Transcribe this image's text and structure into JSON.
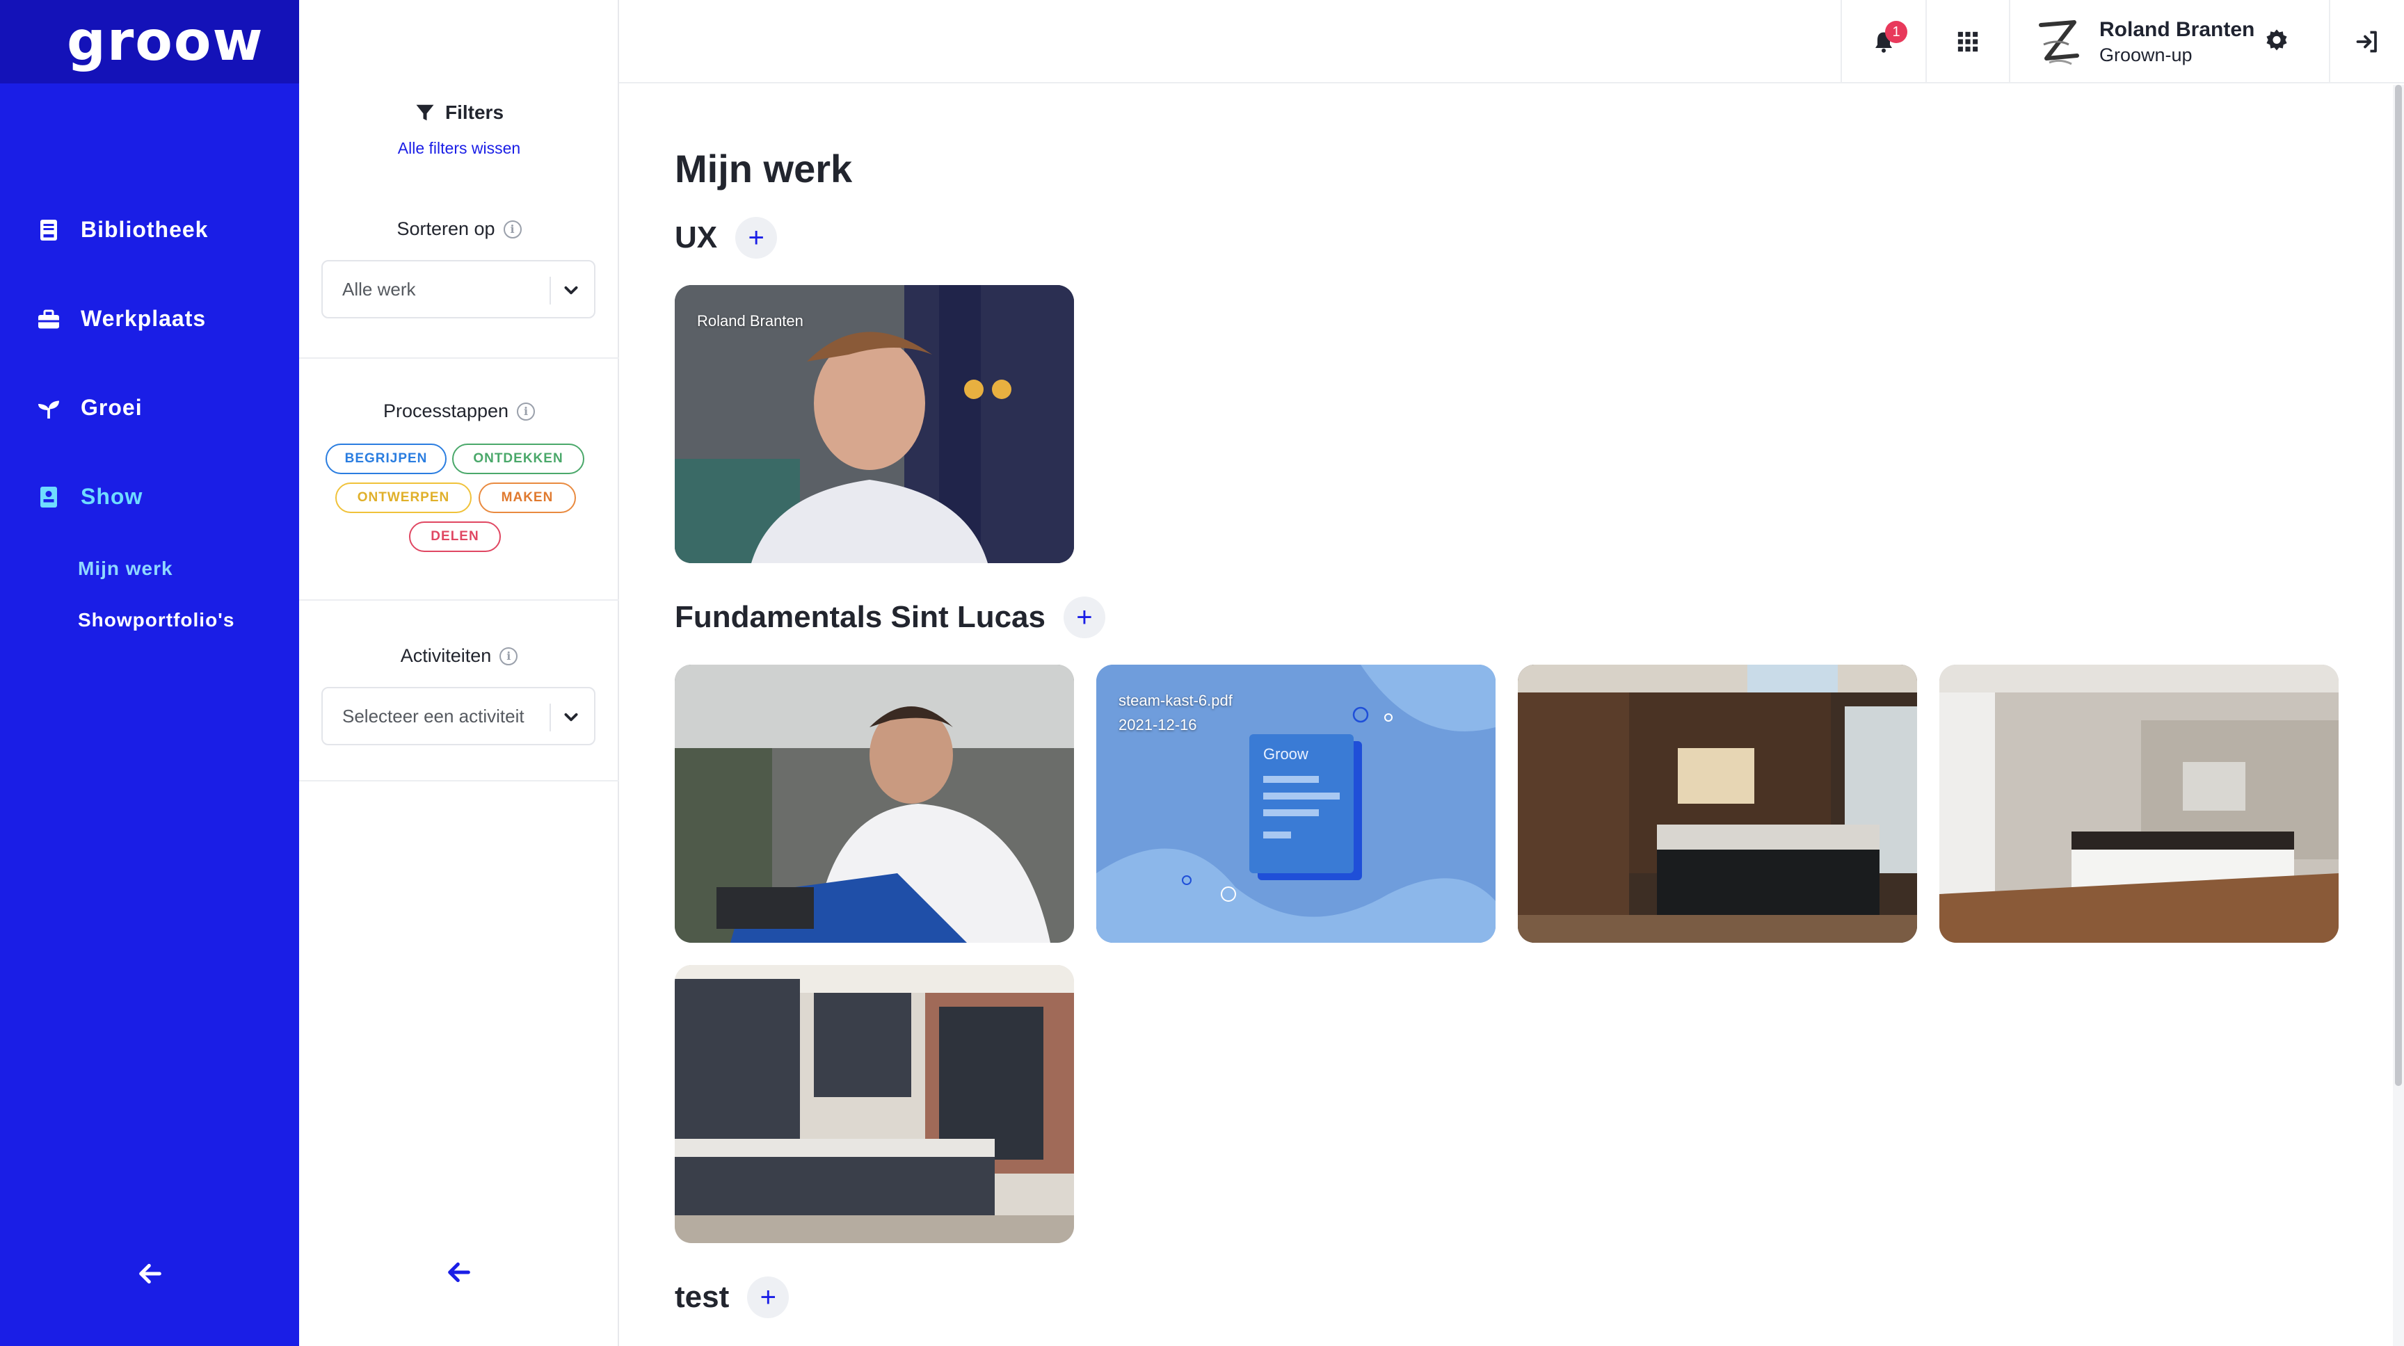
{
  "nav": {
    "logo": "groow",
    "items": [
      {
        "label": "Bibliotheek",
        "icon": "book-icon"
      },
      {
        "label": "Werkplaats",
        "icon": "toolbox-icon"
      },
      {
        "label": "Groei",
        "icon": "sprout-icon"
      },
      {
        "label": "Show",
        "icon": "portfolio-icon"
      }
    ],
    "subitems": [
      {
        "label": "Mijn werk"
      },
      {
        "label": "Showportfolio's"
      }
    ],
    "colors": {
      "background": "#1a1ee6",
      "active": "#6fdcff"
    }
  },
  "filters": {
    "title": "Filters",
    "clear_all": "Alle filters wissen",
    "sort": {
      "label": "Sorteren op",
      "value": "Alle werk"
    },
    "process": {
      "label": "Processtappen",
      "chips": [
        "BEGRIJPEN",
        "ONTDEKKEN",
        "ONTWERPEN",
        "MAKEN",
        "DELEN"
      ]
    },
    "activities": {
      "label": "Activiteiten",
      "value": "Selecteer een activiteit"
    }
  },
  "topbar": {
    "notifications_count": "1",
    "user": {
      "name": "Roland Branten",
      "role": "Groown-up"
    }
  },
  "main": {
    "title": "Mijn werk",
    "groups": [
      {
        "title": "UX",
        "cards": [
          {
            "caption": "Roland Branten"
          }
        ]
      },
      {
        "title": "Fundamentals Sint Lucas",
        "cards": [
          {
            "caption": ""
          },
          {
            "caption": "steam-kast-6.pdf",
            "date": "2021-12-16",
            "doc_label": "Groow"
          },
          {
            "caption": ""
          },
          {
            "caption": ""
          },
          {
            "caption": ""
          }
        ]
      },
      {
        "title": "test",
        "cards": []
      }
    ]
  }
}
